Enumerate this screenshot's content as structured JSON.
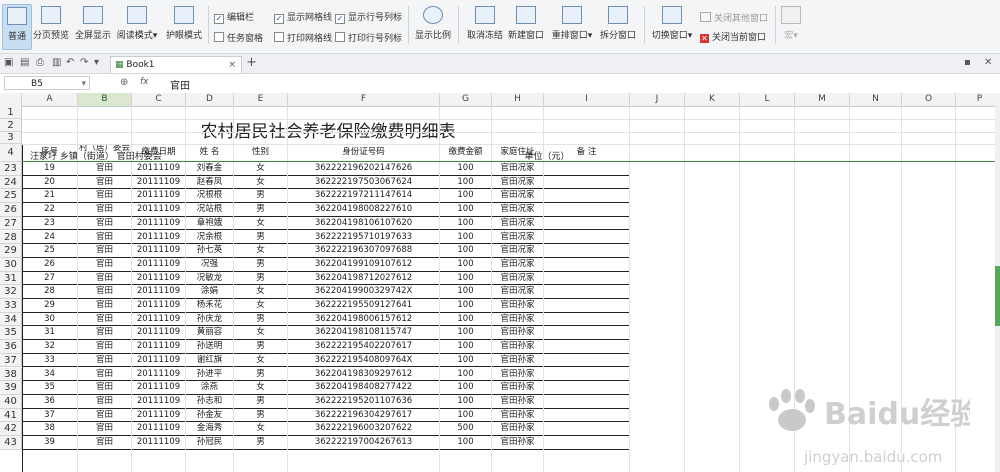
{
  "ribbon": {
    "buttons": [
      {
        "label": "普通",
        "icon": "normal-view-icon",
        "active": true
      },
      {
        "label": "分页预览",
        "icon": "page-break-preview-icon"
      },
      {
        "label": "全屏显示",
        "icon": "fullscreen-icon"
      },
      {
        "label": "阅读模式",
        "icon": "reading-mode-icon"
      },
      {
        "label": "护眼模式",
        "icon": "eye-protection-icon"
      }
    ],
    "checks": [
      {
        "label": "编辑栏",
        "checked": true
      },
      {
        "label": "任务窗格",
        "checked": false
      },
      {
        "label": "显示网格线",
        "checked": true
      },
      {
        "label": "打印网格线",
        "checked": false
      },
      {
        "label": "显示行号列标",
        "checked": true
      },
      {
        "label": "打印行号列标",
        "checked": false
      }
    ],
    "buttons2": [
      {
        "label": "显示比例",
        "icon": "zoom-icon"
      },
      {
        "label": "取消冻结",
        "icon": "unfreeze-icon"
      },
      {
        "label": "新建窗口",
        "icon": "new-window-icon"
      },
      {
        "label": "重排窗口",
        "icon": "arrange-window-icon"
      },
      {
        "label": "拆分窗口",
        "icon": "split-window-icon"
      },
      {
        "label": "切换窗口",
        "icon": "switch-window-icon"
      }
    ],
    "close_other": "关闭其他窗口",
    "close_current": "关闭当前窗口",
    "macro": "宏"
  },
  "tabbar": {
    "doc_title": "Book1"
  },
  "formula": {
    "cell_ref": "B5",
    "fx": "fx",
    "value": "官田"
  },
  "columns": [
    "A",
    "B",
    "C",
    "D",
    "E",
    "F",
    "G",
    "H",
    "I",
    "J",
    "K",
    "L",
    "M",
    "N",
    "O",
    "P"
  ],
  "selected_column": "B",
  "sheet": {
    "title": "农村居民社会养老保险缴费明细表",
    "row3_left": "汪家圩 乡镇（街道）  官田村委会",
    "row3_unit": "单位（元）",
    "headers": [
      "序号",
      "村（居）委会",
      "缴费日期",
      "姓 名",
      "性别",
      "身份证号码",
      "缴费金额",
      "家庭住址",
      "备 注"
    ],
    "header_rows": [
      "1",
      "2",
      "3",
      "4"
    ],
    "rows": [
      {
        "r": "23",
        "c": [
          "19",
          "官田",
          "20111109",
          "刘春金",
          "女",
          "362222196202147626",
          "100",
          "官田况家",
          ""
        ]
      },
      {
        "r": "24",
        "c": [
          "20",
          "官田",
          "20111109",
          "赵春凤",
          "女",
          "362222197503067624",
          "100",
          "官田况家",
          ""
        ]
      },
      {
        "r": "25",
        "c": [
          "21",
          "官田",
          "20111109",
          "况根根",
          "男",
          "362222197211147614",
          "100",
          "官田况家",
          ""
        ]
      },
      {
        "r": "26",
        "c": [
          "22",
          "官田",
          "20111109",
          "况站根",
          "男",
          "362204198008227610",
          "100",
          "官田况家",
          ""
        ]
      },
      {
        "r": "27",
        "c": [
          "23",
          "官田",
          "20111109",
          "章袍娥",
          "女",
          "362204198106107620",
          "100",
          "官田况家",
          ""
        ]
      },
      {
        "r": "28",
        "c": [
          "24",
          "官田",
          "20111109",
          "况余根",
          "男",
          "362222195710197633",
          "100",
          "官田况家",
          ""
        ]
      },
      {
        "r": "29",
        "c": [
          "25",
          "官田",
          "20111109",
          "孙七英",
          "女",
          "362222196307097688",
          "100",
          "官田况家",
          ""
        ]
      },
      {
        "r": "30",
        "c": [
          "26",
          "官田",
          "20111109",
          "况强",
          "男",
          "362204199109107612",
          "100",
          "官田况家",
          ""
        ]
      },
      {
        "r": "31",
        "c": [
          "27",
          "官田",
          "20111109",
          "况敏龙",
          "男",
          "362204198712027612",
          "100",
          "官田况家",
          ""
        ]
      },
      {
        "r": "32",
        "c": [
          "28",
          "官田",
          "20111109",
          "涂娟",
          "女",
          "36220419900329742X",
          "100",
          "官田况家",
          ""
        ]
      },
      {
        "r": "33",
        "c": [
          "29",
          "官田",
          "20111109",
          "杨禾花",
          "女",
          "362222195509127641",
          "100",
          "官田孙家",
          ""
        ]
      },
      {
        "r": "34",
        "c": [
          "30",
          "官田",
          "20111109",
          "孙庆龙",
          "男",
          "362204198006157612",
          "100",
          "官田孙家",
          ""
        ]
      },
      {
        "r": "35",
        "c": [
          "31",
          "官田",
          "20111109",
          "黄丽容",
          "女",
          "362204198108115747",
          "100",
          "官田孙家",
          ""
        ]
      },
      {
        "r": "36",
        "c": [
          "32",
          "官田",
          "20111109",
          "孙送明",
          "男",
          "362222195402207617",
          "100",
          "官田孙家",
          ""
        ]
      },
      {
        "r": "37",
        "c": [
          "33",
          "官田",
          "20111109",
          "谢红旗",
          "女",
          "36222219540809764X",
          "100",
          "官田孙家",
          ""
        ]
      },
      {
        "r": "38",
        "c": [
          "34",
          "官田",
          "20111109",
          "孙进平",
          "男",
          "362204198309297612",
          "100",
          "官田孙家",
          ""
        ]
      },
      {
        "r": "39",
        "c": [
          "35",
          "官田",
          "20111109",
          "涂燕",
          "女",
          "362204198408277422",
          "100",
          "官田孙家",
          ""
        ]
      },
      {
        "r": "40",
        "c": [
          "36",
          "官田",
          "20111109",
          "孙志和",
          "男",
          "362222195201107636",
          "100",
          "官田孙家",
          ""
        ]
      },
      {
        "r": "41",
        "c": [
          "37",
          "官田",
          "20111109",
          "孙金友",
          "男",
          "362222196304297617",
          "100",
          "官田孙家",
          ""
        ]
      },
      {
        "r": "42",
        "c": [
          "38",
          "官田",
          "20111109",
          "金海秀",
          "女",
          "362222196003207622",
          "500",
          "官田孙家",
          ""
        ]
      },
      {
        "r": "43",
        "c": [
          "39",
          "官田",
          "20111109",
          "孙冠民",
          "男",
          "362222197004267613",
          "100",
          "官田孙家",
          ""
        ]
      }
    ]
  },
  "watermark": {
    "brand": "Baidu经验",
    "url": "jingyan.baidu.com"
  }
}
